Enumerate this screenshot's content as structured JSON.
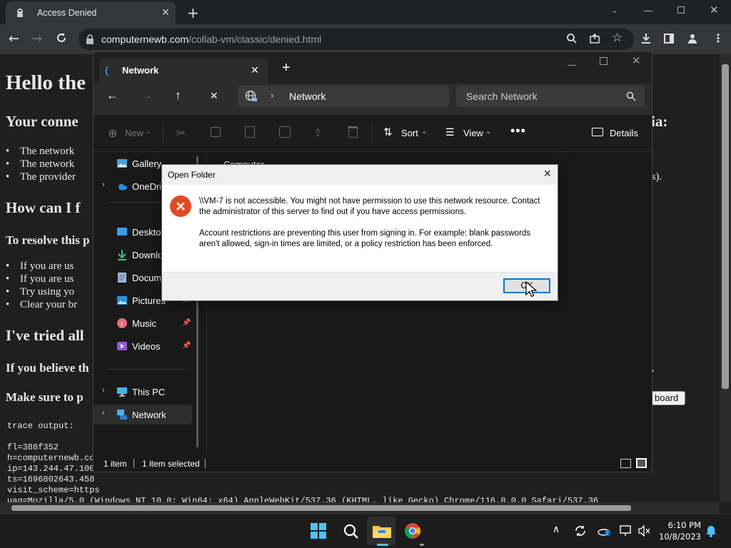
{
  "browser": {
    "tab_title": "Access Denied",
    "url_host": "computernewb.com",
    "url_path": "/collab-vm/classic/denied.html"
  },
  "webpage": {
    "h1": "Hello the",
    "h2_connection": "Your conne",
    "h2_connection_tail": "ia:",
    "bullets_1": [
      "The network",
      "The network",
      "The provider"
    ],
    "bullet_tail": "rks).",
    "h2_fix": "How can I f",
    "h3_resolve": "To resolve this p",
    "bullets_2": [
      "If you are us",
      "If you are us",
      "Try using yo",
      "Clear your br"
    ],
    "h2_tried": "I've tried all",
    "h3_believe": "If you believe th",
    "h3_believe_tail": ".",
    "h3_sure": "Make sure to p",
    "copy_button": "board",
    "trace_title": "trace output:",
    "trace_lines": [
      "fl=388f352",
      "h=computernewb.co",
      "ip=143.244.47.100",
      "ts=1696802643.458",
      "visit_scheme=https",
      "uag=Mozilla/5.0 (Windows NT 10.0; Win64; x64) AppleWebKit/537.36 (KHTML, like Gecko) Chrome/116.0.0.0 Safari/537.36"
    ]
  },
  "explorer": {
    "tab_label": "Network",
    "address": "Network",
    "search_placeholder": "Search Network",
    "cmd": {
      "new": "New",
      "sort": "Sort",
      "view": "View",
      "details": "Details"
    },
    "content_header": "Computer",
    "nav": [
      {
        "label": "Gallery",
        "icon": "gallery-icon"
      },
      {
        "label": "OneDrive",
        "icon": "onedrive-icon"
      },
      {
        "label": "Desktop",
        "icon": "desktop-icon"
      },
      {
        "label": "Downloads",
        "icon": "downloads-icon"
      },
      {
        "label": "Documents",
        "icon": "documents-icon"
      },
      {
        "label": "Pictures",
        "icon": "pictures-icon"
      },
      {
        "label": "Music",
        "icon": "music-icon"
      },
      {
        "label": "Videos",
        "icon": "videos-icon"
      },
      {
        "label": "This PC",
        "icon": "pc-icon"
      },
      {
        "label": "Network",
        "icon": "network-icon"
      }
    ],
    "status": {
      "count": "1 item",
      "selected": "1 item selected"
    }
  },
  "dialog": {
    "title": "Open Folder",
    "message1": "\\\\VM-7 is not accessible. You might not have permission to use this network resource. Contact the administrator of this server to find out if you have access permissions.",
    "message2": "Account restrictions are preventing this user from signing in. For example: blank passwords aren't allowed, sign-in times are limited, or a policy restriction has been enforced.",
    "ok_label": "OK"
  },
  "taskbar": {
    "time": "6:10 PM",
    "date": "10/8/2023"
  },
  "colors": {
    "accent": "#0078d4",
    "error": "#e81123",
    "folder": "#f4c043"
  }
}
